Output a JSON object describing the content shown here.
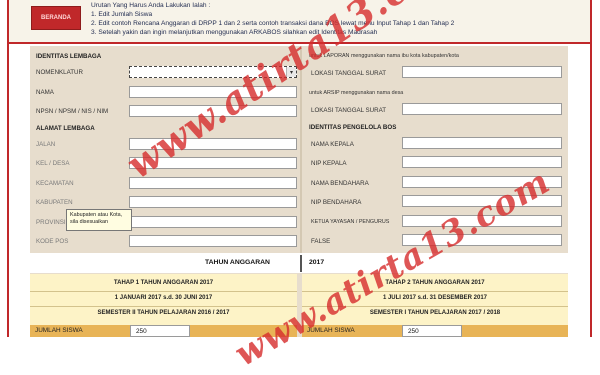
{
  "header": {
    "beranda_label": "BERANDA",
    "notes": [
      "Urutan Yang Harus Anda Lakukan Ialah :",
      "1. Edit Jumlah Siswa",
      "2. Edit contoh Rencana Anggaran di DRPP 1 dan 2 serta contoh transaksi dana BOS lewat menu Input Tahap 1 dan Tahap 2",
      "3. Setelah yakin dan ingin melanjutkan menggunakan ARKABOS silahkan edit Identitas Madrasah"
    ]
  },
  "left": {
    "identitas_title": "IDENTITAS LEMBAGA",
    "nomenklatur_label": "NOMENKLATUR",
    "nama_label": "NAMA",
    "npsn_label": "NPSN / NPSM / NIS / NIM",
    "alamat_title": "ALAMAT LEMBAGA",
    "jalan_label": "JALAN",
    "kel_label": "KEL / DESA",
    "kecamatan_label": "KECAMATAN",
    "kabupaten_label": "KABUPATEN",
    "provinsi_label": "PROVINSI",
    "kodepos_label": "KODE POS",
    "dropdown_icon": "▾"
  },
  "right": {
    "note_laporan": "untuk LAPORAN menggunakan nama ibu kota kabupaten/kota",
    "lokasi_label": "LOKASI TANGGAL SURAT",
    "note_arsip": "untuk ARSIP menggunakan nama desa",
    "lokasi2_label": "LOKASI TANGGAL SURAT",
    "pengelola_title": "IDENTITAS PENGELOLA BOS",
    "kepala_label": "NAMA KEPALA",
    "nip_kepala_label": "NIP KEPALA",
    "bendahara_label": "NAMA BENDAHARA",
    "nip_bendahara_label": "NIP BENDAHARA",
    "ketua_label": "KETUA YAYASAN / PENGURUS",
    "false_label": "FALSE"
  },
  "tooltip": {
    "line1": "Kabupaten atau Kota,",
    "line2": "sila disesuaikan"
  },
  "tahun": {
    "label": "TAHUN ANGGARAN",
    "value": "2017"
  },
  "tahap1": {
    "title": "TAHAP 1 TAHUN ANGGARAN 2017",
    "period": "1 JANUARI 2017 s.d. 30 JUNI 2017",
    "semester": "SEMESTER II TAHUN PELAJARAN 2016 / 2017",
    "siswa_label": "JUMLAH SISWA",
    "siswa_value": "250"
  },
  "tahap2": {
    "title": "TAHAP 2 TAHUN ANGGARAN 2017",
    "period": "1 JULI 2017 s.d. 31 DESEMBER 2017",
    "semester": "SEMESTER I TAHUN PELAJARAN 2017 / 2018",
    "siswa_label": "JUMLAH SISWA",
    "siswa_value": "250"
  },
  "watermark": {
    "line1": "www.atirta13.com",
    "line2": "www.atirta13.com"
  }
}
